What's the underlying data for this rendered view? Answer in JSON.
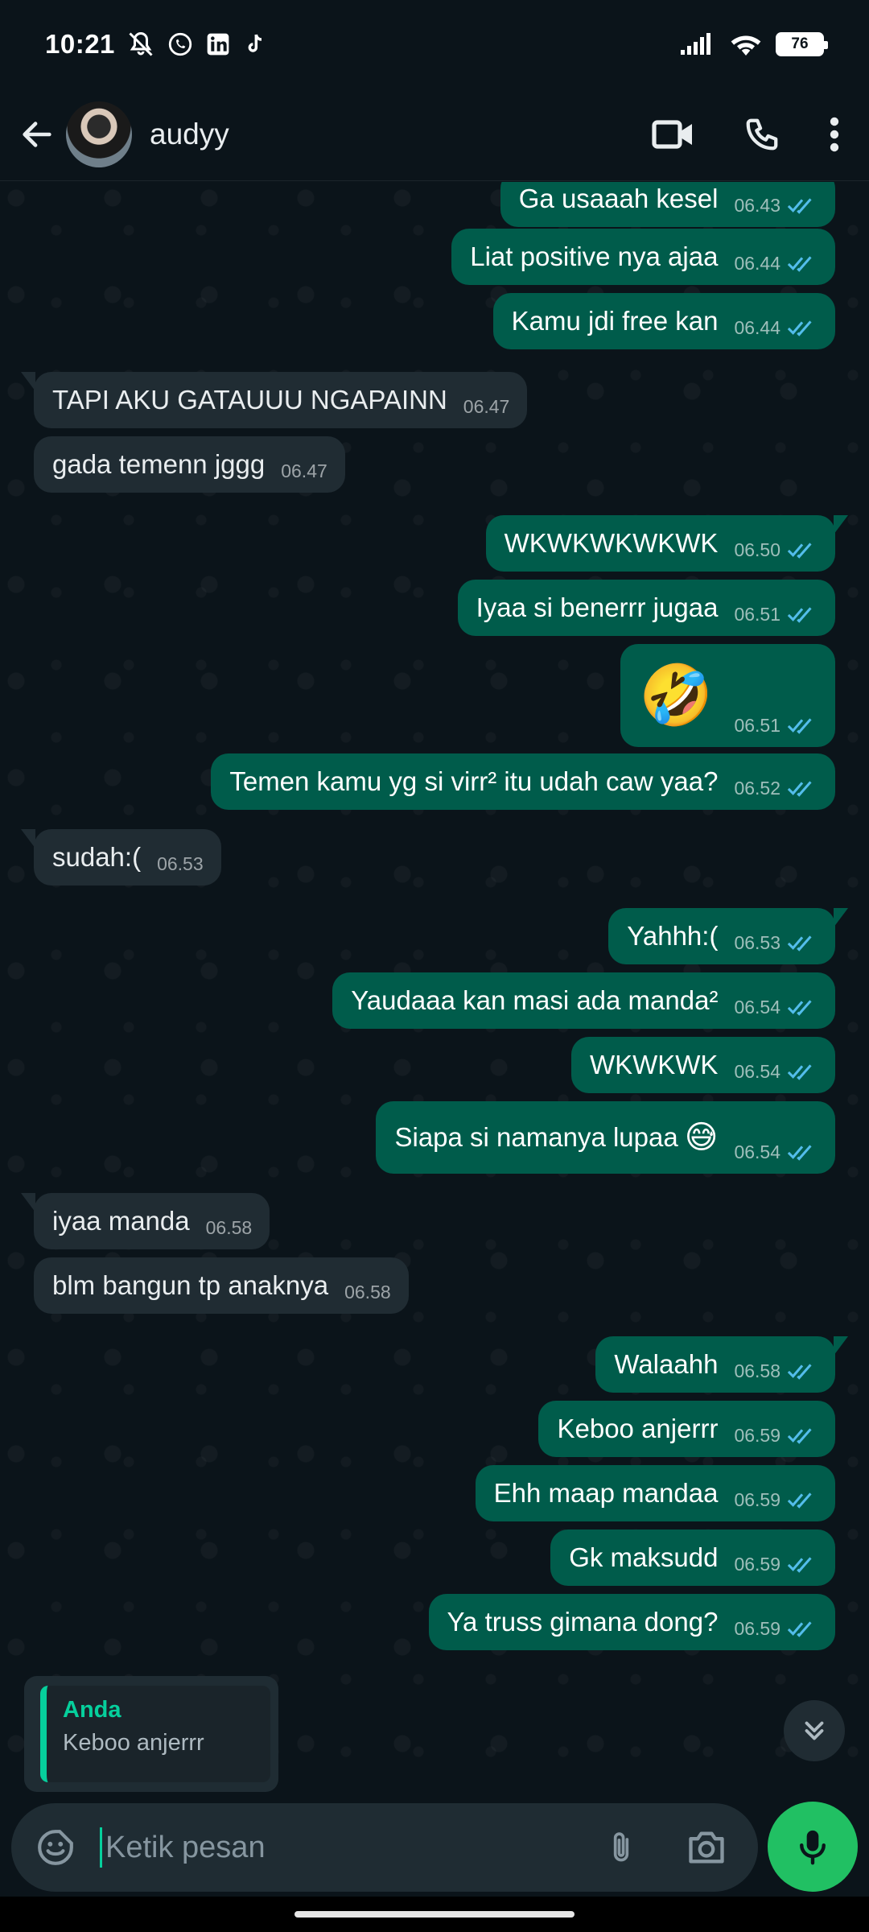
{
  "status_bar": {
    "time": "10:21",
    "battery": "76"
  },
  "header": {
    "contact_name": "audyy"
  },
  "messages": [
    {
      "dir": "out",
      "text": "Ga usaaah kesel",
      "time": "06.43"
    },
    {
      "dir": "out",
      "text": "Liat positive nya ajaa",
      "time": "06.44"
    },
    {
      "dir": "out",
      "text": "Kamu jdi free kan",
      "time": "06.44"
    },
    {
      "dir": "in",
      "text": "TAPI AKU GATAUUU NGAPAINN",
      "time": "06.47"
    },
    {
      "dir": "in",
      "text": "gada temenn jggg",
      "time": "06.47"
    },
    {
      "dir": "out",
      "text": "WKWKWKWKWK",
      "time": "06.50"
    },
    {
      "dir": "out",
      "text": "Iyaa si benerrr jugaa",
      "time": "06.51"
    },
    {
      "dir": "out",
      "text": "🤣",
      "time": "06.51"
    },
    {
      "dir": "out",
      "text": "Temen kamu yg si virr² itu udah caw yaa?",
      "time": "06.52"
    },
    {
      "dir": "in",
      "text": "sudah:(",
      "time": "06.53"
    },
    {
      "dir": "out",
      "text": "Yahhh:(",
      "time": "06.53"
    },
    {
      "dir": "out",
      "text": "Yaudaaa kan masi ada manda²",
      "time": "06.54"
    },
    {
      "dir": "out",
      "text": "WKWKWK",
      "time": "06.54"
    },
    {
      "dir": "out",
      "text": "Siapa si namanya lupaa",
      "emoji": "😅",
      "time": "06.54"
    },
    {
      "dir": "in",
      "text": "iyaa manda",
      "time": "06.58"
    },
    {
      "dir": "in",
      "text": "blm bangun tp anaknya",
      "time": "06.58"
    },
    {
      "dir": "out",
      "text": "Walaahh",
      "time": "06.58"
    },
    {
      "dir": "out",
      "text": "Keboo anjerrr",
      "time": "06.59"
    },
    {
      "dir": "out",
      "text": "Ehh maap mandaa",
      "time": "06.59"
    },
    {
      "dir": "out",
      "text": "Gk maksudd",
      "time": "06.59"
    },
    {
      "dir": "out",
      "text": "Ya truss gimana dong?",
      "time": "06.59"
    }
  ],
  "reply_preview": {
    "author": "Anda",
    "text": "Keboo anjerrr"
  },
  "composer": {
    "placeholder": "Ketik pesan"
  },
  "colors": {
    "outgoing": "#005c4b",
    "incoming": "#202c33",
    "accent": "#21c063",
    "read_ticks": "#53bdeb"
  },
  "icons": [
    "back-arrow-icon",
    "video-call-icon",
    "phone-icon",
    "more-options-icon",
    "emoji-sticker-icon",
    "attach-icon",
    "camera-icon",
    "mic-icon",
    "chevron-double-down-icon"
  ]
}
